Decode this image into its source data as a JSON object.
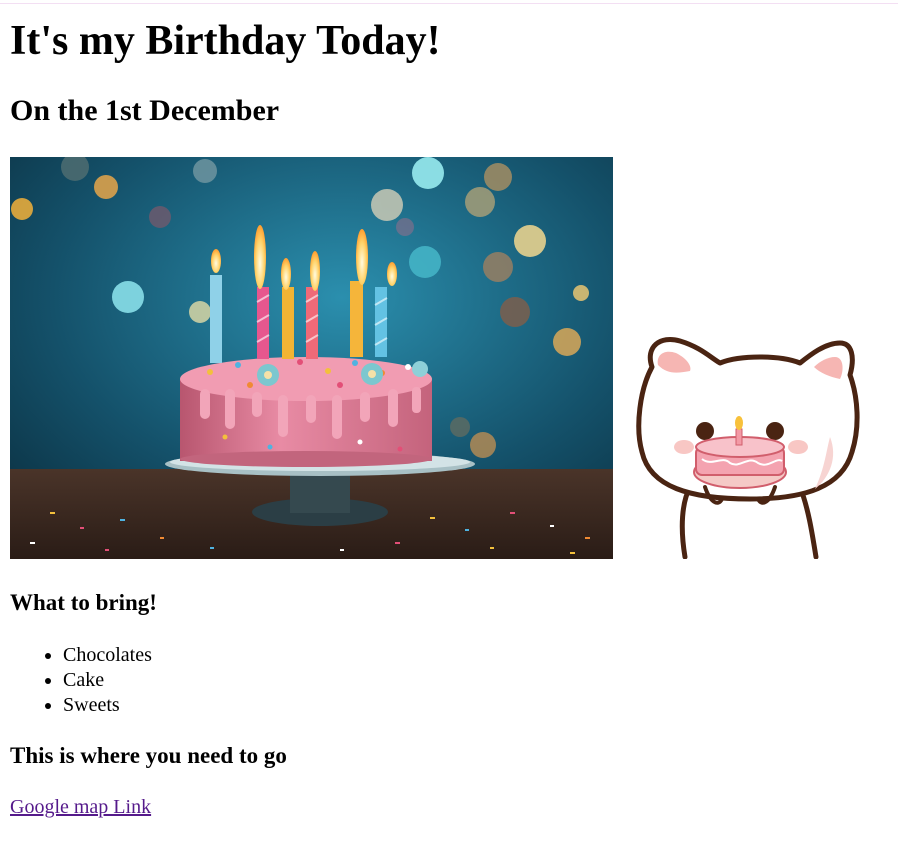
{
  "page": {
    "title": "It's my Birthday Today!",
    "subtitle": "On the 1st December"
  },
  "images": {
    "cake_alt": "birthday cake with candles",
    "cat_alt": "cat with cake"
  },
  "bring": {
    "heading": "What to bring!",
    "items": [
      "Chocolates",
      "Cake",
      "Sweets"
    ]
  },
  "location": {
    "heading": "This is where you need to go",
    "link_text": "Google map Link"
  },
  "colors": {
    "link_visited": "#551a8b",
    "cake_frosting": "#e07b9a",
    "background_bokeh": "#1f6b86"
  }
}
